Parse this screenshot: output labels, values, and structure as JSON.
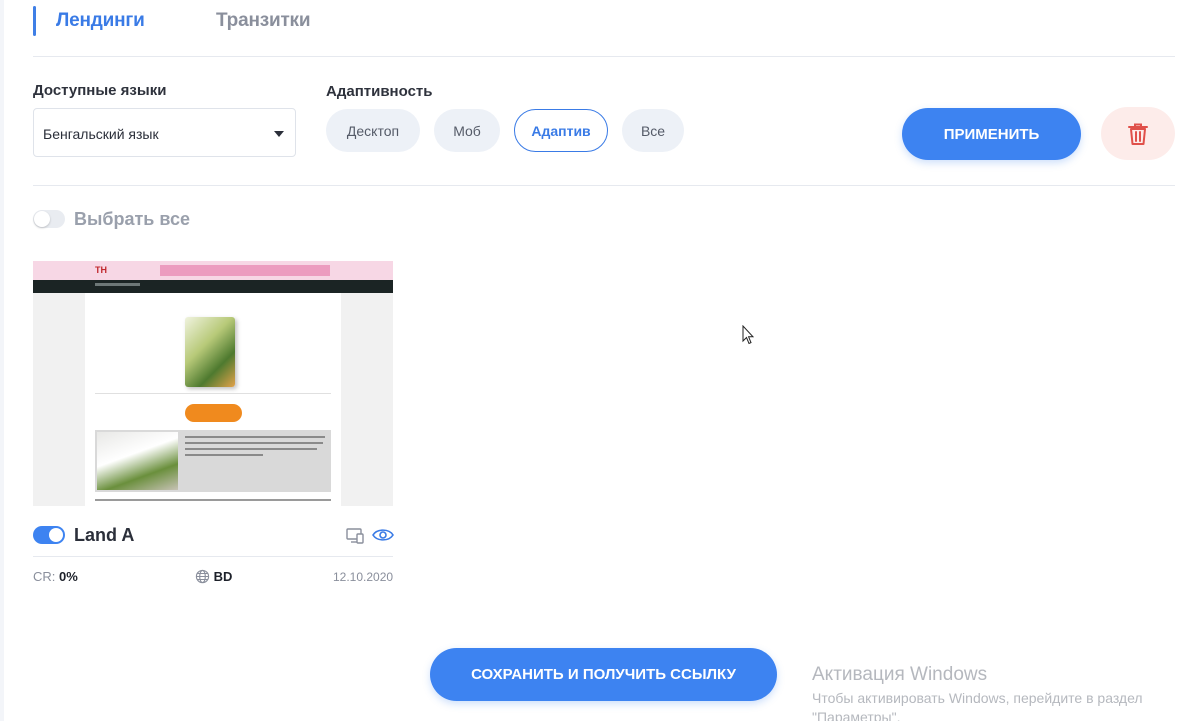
{
  "tabs": [
    {
      "label": "Лендинги",
      "active": true
    },
    {
      "label": "Транзитки",
      "active": false
    }
  ],
  "filters": {
    "languages_label": "Доступные языки",
    "language_value": "Бенгальский язык",
    "adaptivity_label": "Адаптивность",
    "adaptivity_options": [
      {
        "label": "Десктоп",
        "active": false
      },
      {
        "label": "Моб",
        "active": false
      },
      {
        "label": "Адаптив",
        "active": true
      },
      {
        "label": "Все",
        "active": false
      }
    ],
    "apply_label": "ПРИМЕНИТЬ"
  },
  "select_all": {
    "label": "Выбрать все",
    "enabled": false
  },
  "card": {
    "title": "Land A",
    "enabled": true,
    "preview_logo": "TH",
    "cr_label": "CR:",
    "cr_value": "0%",
    "country": "BD",
    "date": "12.10.2020"
  },
  "save_label": "СОХРАНИТЬ И ПОЛУЧИТЬ ССЫЛКУ",
  "watermark": {
    "title": "Активация Windows",
    "line1": "Чтобы активировать Windows, перейдите в раздел",
    "line2": "\"Параметры\"."
  },
  "colors": {
    "accent": "#3d83f1",
    "delete_bg": "#fdecea",
    "delete_icon": "#e0504a"
  }
}
